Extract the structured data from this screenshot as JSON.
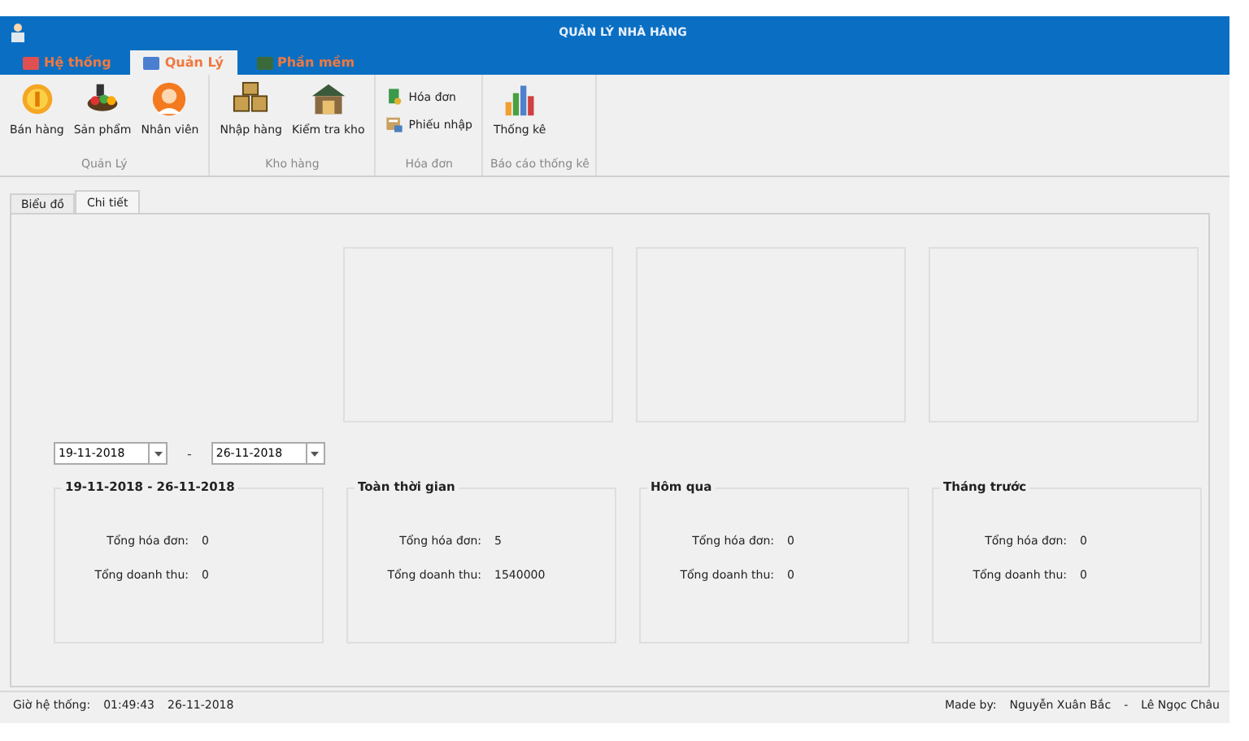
{
  "window": {
    "title": "QUẢN LÝ NHÀ HÀNG"
  },
  "ribbon_tabs": [
    {
      "label": "Hệ thống",
      "selected": false
    },
    {
      "label": "Quản Lý",
      "selected": true
    },
    {
      "label": "Phần mềm",
      "selected": false
    }
  ],
  "ribbon_groups": [
    {
      "label": "Quản Lý",
      "kind": "large",
      "buttons": [
        {
          "label": "Bán hàng"
        },
        {
          "label": "Sản phẩm"
        },
        {
          "label": "Nhân viên"
        }
      ]
    },
    {
      "label": "Kho hàng",
      "kind": "large",
      "buttons": [
        {
          "label": "Nhập hàng"
        },
        {
          "label": "Kiểm tra kho"
        }
      ]
    },
    {
      "label": "Hóa đơn",
      "kind": "small",
      "buttons": [
        {
          "label": "Hóa đơn"
        },
        {
          "label": "Phiếu nhập"
        }
      ]
    },
    {
      "label": "Báo cáo thống kê",
      "kind": "large",
      "buttons": [
        {
          "label": "Thống kê"
        }
      ]
    }
  ],
  "content_tabs": [
    {
      "label": "Biểu đồ",
      "selected": false
    },
    {
      "label": "Chi tiết",
      "selected": true
    }
  ],
  "date_from": {
    "value": "19-11-2018"
  },
  "date_separator": "-",
  "date_to": {
    "value": "26-11-2018"
  },
  "summary_groups": [
    {
      "title": "19-11-2018 - 26-11-2018",
      "rows": [
        {
          "label": "Tổng hóa đơn:",
          "value": "0"
        },
        {
          "label": "Tổng doanh thu:",
          "value": "0"
        }
      ]
    },
    {
      "title": "Toàn thời gian",
      "rows": [
        {
          "label": "Tổng hóa đơn:",
          "value": "5"
        },
        {
          "label": "Tổng doanh thu:",
          "value": "1540000"
        }
      ]
    },
    {
      "title": "Hôm qua",
      "rows": [
        {
          "label": "Tổng hóa đơn:",
          "value": "0"
        },
        {
          "label": "Tổng doanh thu:",
          "value": "0"
        }
      ]
    },
    {
      "title": "Tháng trước",
      "rows": [
        {
          "label": "Tổng hóa đơn:",
          "value": "0"
        },
        {
          "label": "Tổng doanh thu:",
          "value": "0"
        }
      ]
    }
  ],
  "status_bar": {
    "clock_label": "Giờ hệ thống:",
    "time": "01:49:43",
    "date": "26-11-2018",
    "made_by_label": "Made by:",
    "authors": [
      "Nguyễn Xuân Bắc",
      "Lê Ngọc Châu"
    ],
    "author_separator": "-"
  }
}
